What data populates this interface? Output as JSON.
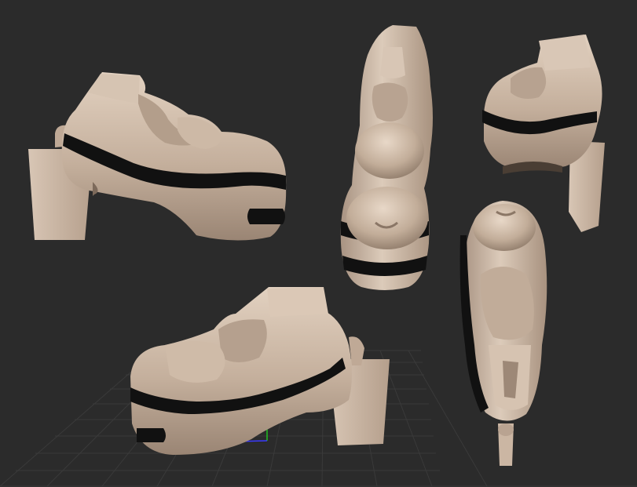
{
  "scene": {
    "background_color": "#2b2b2b",
    "grid_color": "#3a3a3a",
    "model_color": "#c8b4a2",
    "model_shadow_color": "#8f7c6c",
    "model_highlight_color": "#e4d3c3",
    "stripe_color": "#111111",
    "axis_x_color": "#3a3aff",
    "axis_y_color": "#20c020",
    "views": [
      {
        "name": "side-left-view"
      },
      {
        "name": "top-view"
      },
      {
        "name": "three-quarter-view"
      },
      {
        "name": "side-right-view"
      },
      {
        "name": "bottom-front-view"
      }
    ]
  }
}
